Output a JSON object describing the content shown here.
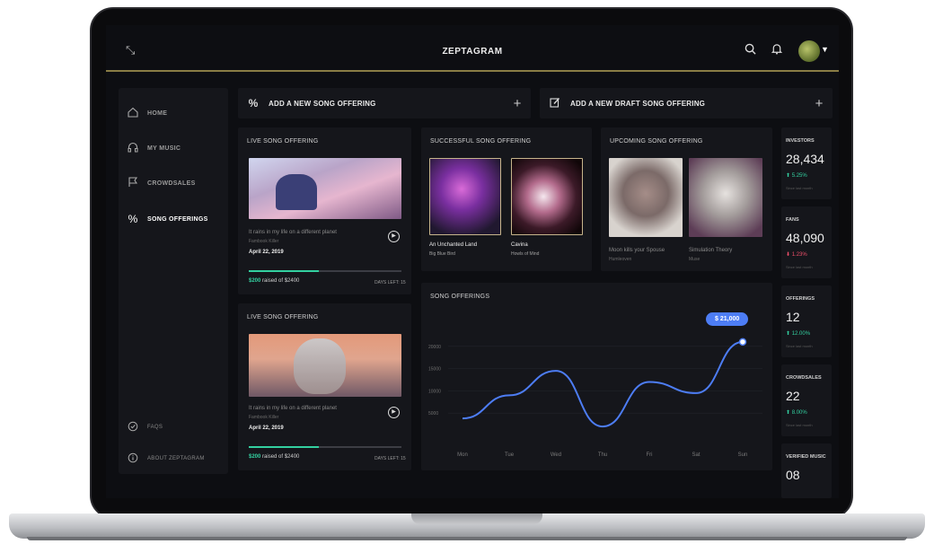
{
  "app": {
    "brand": "ZEPTAGRAM"
  },
  "icons": {
    "collapse": "collapse-arrows-icon",
    "search": "search-icon",
    "bell": "bell-icon",
    "caret": "caret-down-icon"
  },
  "sidebar": {
    "items": [
      {
        "label": "HOME",
        "icon": "home-icon"
      },
      {
        "label": "MY MUSIC",
        "icon": "headphones-icon"
      },
      {
        "label": "CROWDSALES",
        "icon": "flag-icon"
      },
      {
        "label": "SONG OFFERINGS",
        "icon": "percent-icon"
      }
    ],
    "bottom": [
      {
        "label": "FAQS",
        "icon": "check-circle-icon"
      },
      {
        "label": "ABOUT ZEPTAGRAM",
        "icon": "info-icon"
      }
    ]
  },
  "actions": {
    "add_song": "ADD A NEW SONG OFFERING",
    "add_draft": "ADD A NEW  DRAFT SONG OFFERING"
  },
  "live_offerings": [
    {
      "title": "LIVE SONG OFFERING",
      "song": "It rains in my life on a different planet",
      "artist": "Fambook Killer",
      "date": "April 22, 2019",
      "raised_amount": "$200",
      "raised_text": "raised of $2400",
      "days_left": "DAYS LEFT: 15",
      "progress": 0.46
    },
    {
      "title": "LIVE SONG OFFERING",
      "song": "It rains in my life on a different planet",
      "artist": "Fambook Killer",
      "date": "April 22, 2019",
      "raised_amount": "$200",
      "raised_text": "raised of $2400",
      "days_left": "DAYS LEFT: 15",
      "progress": 0.46
    }
  ],
  "successful": {
    "title": "SUCCESSFUL SONG OFFERING",
    "items": [
      {
        "song": "An Unchanted Land",
        "artist": "Big Blue Bird"
      },
      {
        "song": "Cavina",
        "artist": "Howls of Mind"
      }
    ]
  },
  "upcoming": {
    "title": "UPCOMING SONG OFFERING",
    "items": [
      {
        "song": "Moon kills your Spouse",
        "artist": "Humleoven"
      },
      {
        "song": "Simulation Theory",
        "artist": "Muse"
      }
    ]
  },
  "stats": [
    {
      "label": "INVESTORS",
      "value": "28,434",
      "change": "5.25%",
      "direction": "up",
      "note": "Since last month"
    },
    {
      "label": "FANS",
      "value": "48,090",
      "change": "1.23%",
      "direction": "down",
      "note": "Since last month"
    },
    {
      "label": "OFFERINGS",
      "value": "12",
      "change": "12.00%",
      "direction": "up",
      "note": "Since last month"
    },
    {
      "label": "CROWDSALES",
      "value": "22",
      "change": "8.00%",
      "direction": "up",
      "note": "Since last month"
    },
    {
      "label": "VERIFIED MUSIC",
      "value": "08"
    }
  ],
  "chart_data": {
    "type": "line",
    "title": "SONG OFFERINGS",
    "categories": [
      "Mon",
      "Tue",
      "Wed",
      "Thu",
      "Fri",
      "Sat",
      "Sun"
    ],
    "yticks": [
      "20000",
      "15000",
      "10000",
      "5000"
    ],
    "ylim": [
      0,
      25000
    ],
    "series": [
      {
        "values": [
          3800,
          9000,
          14500,
          2000,
          12000,
          9500,
          21000
        ]
      }
    ],
    "tooltip": "$ 21,000",
    "color": "#4d7df5"
  }
}
